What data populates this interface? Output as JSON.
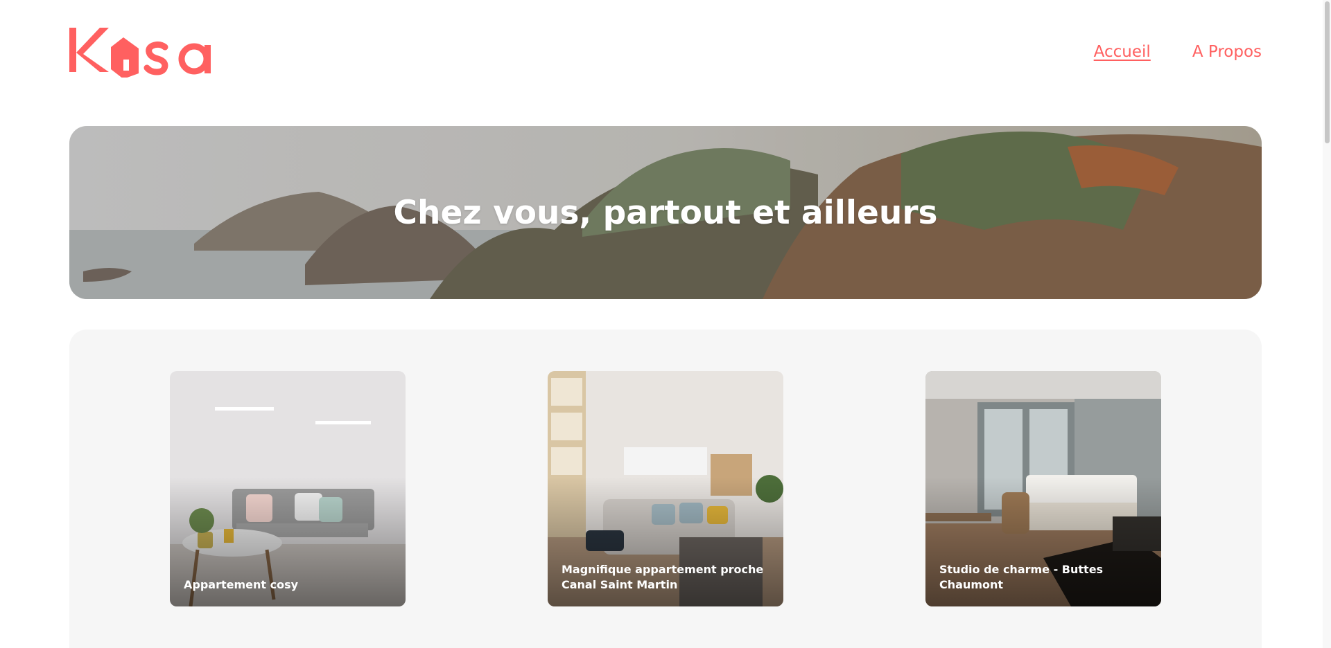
{
  "brand": {
    "name": "Kasa",
    "accent_color": "#ff6060"
  },
  "nav": {
    "items": [
      {
        "label": "Accueil",
        "active": true
      },
      {
        "label": "A Propos",
        "active": false
      }
    ]
  },
  "banner": {
    "title": "Chez vous, partout et ailleurs"
  },
  "gallery": {
    "cards": [
      {
        "title": "Appartement cosy"
      },
      {
        "title": "Magnifique appartement proche Canal Saint Martin"
      },
      {
        "title": "Studio de charme - Buttes Chaumont"
      }
    ]
  }
}
